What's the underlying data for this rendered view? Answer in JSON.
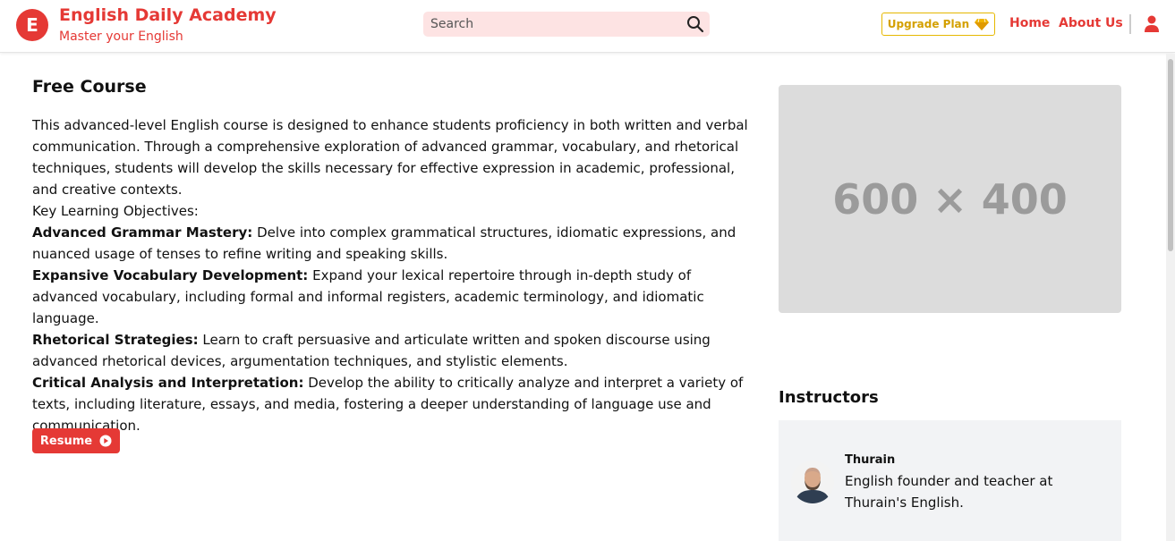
{
  "header": {
    "logo_letter": "E",
    "brand_title": "English Daily Academy",
    "brand_subtitle": "Master your English",
    "search_placeholder": "Search",
    "upgrade_label": "Upgrade Plan",
    "nav": [
      {
        "label": "Home"
      },
      {
        "label": "About Us"
      }
    ],
    "icons": {
      "search": "search-icon",
      "upgrade": "gem-icon",
      "user": "user-icon"
    }
  },
  "main": {
    "title": "Free Course",
    "intro": "This advanced-level English course is designed to enhance students proficiency in both written and verbal communication. Through a comprehensive exploration of advanced grammar, vocabulary, and rhetorical techniques, students will develop the skills necessary for effective expression in academic, professional, and creative contexts.",
    "objectives_heading": "Key Learning Objectives:",
    "objectives": [
      {
        "title": "Advanced Grammar Mastery:",
        "text": "Delve into complex grammatical structures, idiomatic expressions, and nuanced usage of tenses to refine writing and speaking skills."
      },
      {
        "title": "Expansive Vocabulary Development:",
        "text": "Expand your lexical repertoire through in-depth study of advanced vocabulary, including formal and informal registers, academic terminology, and idiomatic language."
      },
      {
        "title": "Rhetorical Strategies:",
        "text": "Learn to craft persuasive and articulate written and spoken discourse using advanced rhetorical devices, argumentation techniques, and stylistic elements."
      },
      {
        "title": "Critical Analysis and Interpretation:",
        "text": "Develop the ability to critically analyze and interpret a variety of texts, including literature, essays, and media, fostering a deeper understanding of language use and communication."
      }
    ],
    "resume_label": "Resume"
  },
  "sidebar": {
    "image_placeholder": "600 × 400",
    "instructors_title": "Instructors",
    "instructor": {
      "name": "Thurain",
      "bio": "English founder and teacher at Thurain's English."
    }
  },
  "colors": {
    "accent": "#e53935",
    "search_bg": "#fde3e3",
    "upgrade": "#d4a000",
    "placeholder_bg": "#dcdcdc",
    "card_bg": "#f2f3f5"
  }
}
